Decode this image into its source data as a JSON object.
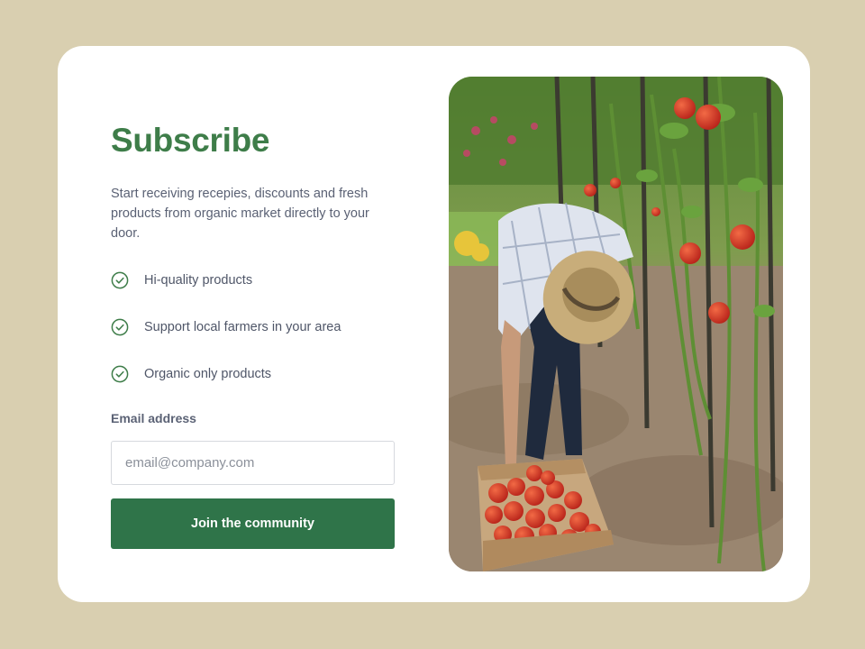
{
  "subscribe": {
    "title": "Subscribe",
    "description": "Start receiving recepies, discounts and fresh products from organic market directly to your door.",
    "features": [
      {
        "text": "Hi-quality products",
        "icon": "check-circle-icon"
      },
      {
        "text": "Support local farmers in your area",
        "icon": "check-circle-icon"
      },
      {
        "text": "Organic only products",
        "icon": "check-circle-icon"
      }
    ],
    "email": {
      "label": "Email address",
      "placeholder": "email@company.com",
      "value": ""
    },
    "button_label": "Join the community"
  },
  "colors": {
    "page_background": "#d9cfb0",
    "card_background": "#ffffff",
    "title": "#3e7d49",
    "button": "#2f7449",
    "check_icon": "#3e7d49"
  }
}
